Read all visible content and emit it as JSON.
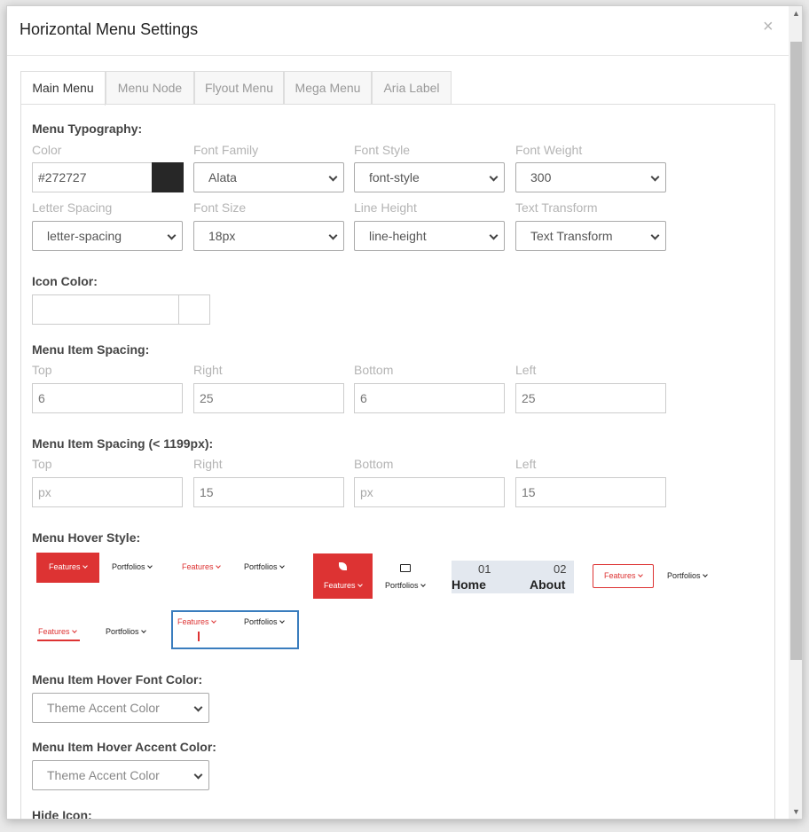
{
  "modal": {
    "title": "Horizontal Menu Settings",
    "close": "×"
  },
  "tabs": [
    "Main Menu",
    "Menu Node",
    "Flyout Menu",
    "Mega Menu",
    "Aria Label"
  ],
  "typography": {
    "heading": "Menu Typography:",
    "color_label": "Color",
    "color_value": "#272727",
    "swatch_color": "#272727",
    "font_family_label": "Font Family",
    "font_family_value": "Alata",
    "font_style_label": "Font Style",
    "font_style_value": "font-style",
    "font_weight_label": "Font Weight",
    "font_weight_value": "300",
    "letter_spacing_label": "Letter Spacing",
    "letter_spacing_value": "letter-spacing",
    "font_size_label": "Font Size",
    "font_size_value": "18px",
    "line_height_label": "Line Height",
    "line_height_value": "line-height",
    "text_transform_label": "Text Transform",
    "text_transform_value": "Text Transform"
  },
  "icon_color": {
    "heading": "Icon Color:",
    "value": ""
  },
  "spacing": {
    "heading": "Menu Item Spacing:",
    "top_label": "Top",
    "top_value": "6",
    "right_label": "Right",
    "right_value": "25",
    "bottom_label": "Bottom",
    "bottom_value": "6",
    "left_label": "Left",
    "left_value": "25"
  },
  "spacing_small": {
    "heading": "Menu Item Spacing (< 1199px):",
    "top_label": "Top",
    "top_placeholder": "px",
    "right_label": "Right",
    "right_value": "15",
    "bottom_label": "Bottom",
    "bottom_placeholder": "px",
    "left_label": "Left",
    "left_value": "15"
  },
  "hover_style": {
    "heading": "Menu Hover Style:",
    "features": "Features",
    "portfolios": "Portfolios",
    "home_num": "01",
    "home": "Home",
    "about_num": "02",
    "about": "About",
    "accent_color": "#dd3333"
  },
  "hover_font_color": {
    "heading": "Menu Item Hover Font Color:",
    "value": "Theme Accent Color"
  },
  "hover_accent_color": {
    "heading": "Menu Item Hover Accent Color:",
    "value": "Theme Accent Color"
  },
  "hide_icon": {
    "heading": "Hide Icon:"
  }
}
